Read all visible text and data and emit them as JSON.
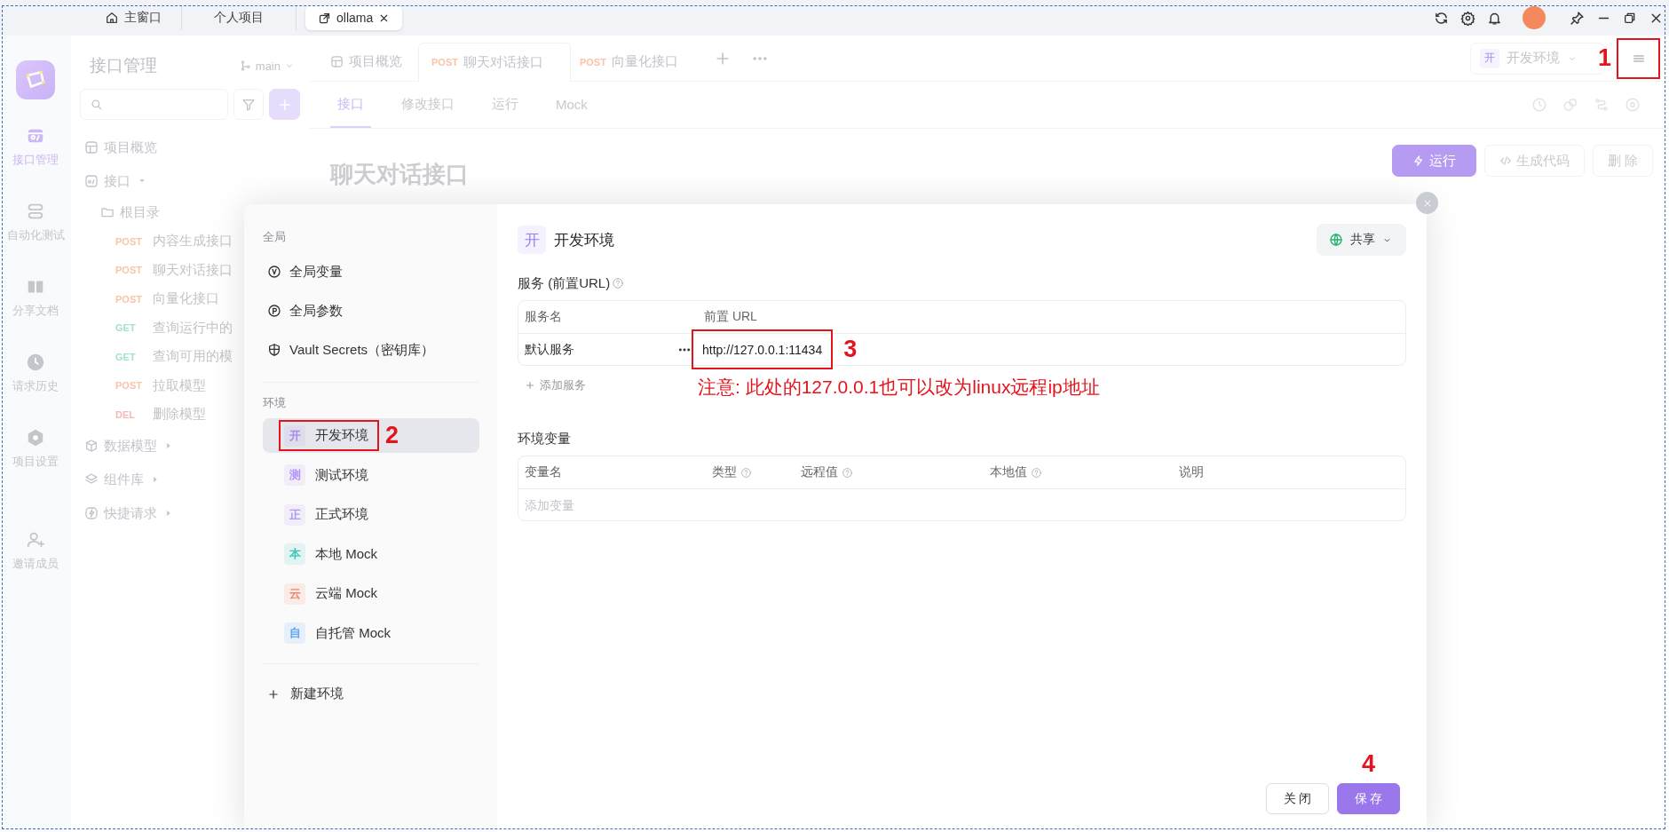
{
  "title_bar": {
    "tabs": [
      {
        "label": "主窗口",
        "selected": false
      },
      {
        "label": "个人项目",
        "selected": false
      },
      {
        "label": "ollama",
        "selected": true
      }
    ]
  },
  "nav_rail": {
    "items": [
      {
        "label": "接口管理",
        "selected": true
      },
      {
        "label": "自动化测试",
        "selected": false
      },
      {
        "label": "分享文档",
        "selected": false
      },
      {
        "label": "请求历史",
        "selected": false
      },
      {
        "label": "项目设置",
        "selected": false
      },
      {
        "label": "邀请成员",
        "selected": false
      }
    ]
  },
  "sidebar": {
    "title": "接口管理",
    "branch": "main",
    "tree": [
      {
        "kind": "page",
        "label": "项目概览"
      },
      {
        "kind": "group",
        "label": "接口",
        "expanded": true,
        "children": [
          {
            "kind": "folder",
            "label": "根目录",
            "children": [
              {
                "kind": "endpoint",
                "method": "POST",
                "color": "#f9c4a8",
                "label": "内容生成接口"
              },
              {
                "kind": "endpoint",
                "method": "POST",
                "color": "#f9c4a8",
                "label": "聊天对话接口"
              },
              {
                "kind": "endpoint",
                "method": "POST",
                "color": "#f9c4a8",
                "label": "向量化接口"
              },
              {
                "kind": "endpoint",
                "method": "GET",
                "color": "#a6e3c6",
                "label": "查询运行中的"
              },
              {
                "kind": "endpoint",
                "method": "GET",
                "color": "#a6e3c6",
                "label": "查询可用的模"
              },
              {
                "kind": "endpoint",
                "method": "POST",
                "color": "#f9c4a8",
                "label": "拉取模型"
              },
              {
                "kind": "endpoint",
                "method": "DEL",
                "color": "#f8b8b8",
                "label": "删除模型"
              }
            ]
          }
        ]
      },
      {
        "kind": "group",
        "label": "数据模型",
        "expanded": false
      },
      {
        "kind": "group",
        "label": "组件库",
        "expanded": false
      },
      {
        "kind": "group",
        "label": "快捷请求",
        "expanded": false
      }
    ]
  },
  "tabs": [
    {
      "kind": "page",
      "label": "项目概览",
      "selected": false
    },
    {
      "kind": "endpoint",
      "method": "POST",
      "color": "#f9c4a8",
      "label": "聊天对话接口",
      "selected": true
    },
    {
      "kind": "endpoint",
      "method": "POST",
      "color": "#f9c4a8",
      "label": "向量化接口",
      "selected": false
    }
  ],
  "env_selector": {
    "badge": "开",
    "label": "开发环境"
  },
  "menu_button": {
    "annotation": "1"
  },
  "sub_tabs": [
    {
      "label": "接口",
      "selected": true
    },
    {
      "label": "修改接口",
      "selected": false
    },
    {
      "label": "运行",
      "selected": false
    },
    {
      "label": "Mock",
      "selected": false
    }
  ],
  "endpoint": {
    "title": "聊天对话接口",
    "actions": [
      {
        "kind": "primary",
        "label": "运行"
      },
      {
        "kind": "code",
        "label": "生成代码"
      },
      {
        "kind": "default",
        "label": "删 除"
      }
    ]
  },
  "modal": {
    "global_heading": "全局",
    "global_items": [
      {
        "label": "全局变量"
      },
      {
        "label": "全局参数"
      },
      {
        "label": "Vault Secrets（密钥库）"
      }
    ],
    "env_heading": "环境",
    "environments": [
      {
        "badge": "开",
        "label": "开发环境",
        "color": "#a98bf0",
        "selected": true,
        "annotation": "2"
      },
      {
        "badge": "测",
        "label": "测试环境",
        "color": "#b197f5",
        "selected": false
      },
      {
        "badge": "正",
        "label": "正式环境",
        "color": "#b197f5",
        "selected": false
      },
      {
        "badge": "本",
        "label": "本地 Mock",
        "color": "#3cc6b9",
        "selected": false
      },
      {
        "badge": "云",
        "label": "云端 Mock",
        "color": "#f0876a",
        "selected": false
      },
      {
        "badge": "自",
        "label": "自托管 Mock",
        "color": "#5fa8f2",
        "selected": false
      }
    ],
    "new_env": "新建环境",
    "detail": {
      "badge": "开",
      "title": "开发环境",
      "share": "共享",
      "services_label": "服务 (前置URL)",
      "services_columns": [
        "服务名",
        "前置 URL"
      ],
      "services": [
        {
          "name": "默认服务",
          "url": "http://127.0.0.1:11434",
          "annotation": "3"
        }
      ],
      "add_service": "添加服务",
      "note": "注意: 此处的127.0.0.1也可以改为linux远程ip地址",
      "variables_label": "环境变量",
      "variables_columns": [
        {
          "label": "变量名",
          "help": false
        },
        {
          "label": "类型",
          "help": true
        },
        {
          "label": "远程值",
          "help": true
        },
        {
          "label": "本地值",
          "help": true
        },
        {
          "label": "说明",
          "help": false
        }
      ],
      "variable_placeholder": "添加变量"
    },
    "footer": [
      {
        "kind": "default",
        "label": "关 闭"
      },
      {
        "kind": "primary",
        "label": "保 存",
        "annotation": "4"
      }
    ]
  }
}
